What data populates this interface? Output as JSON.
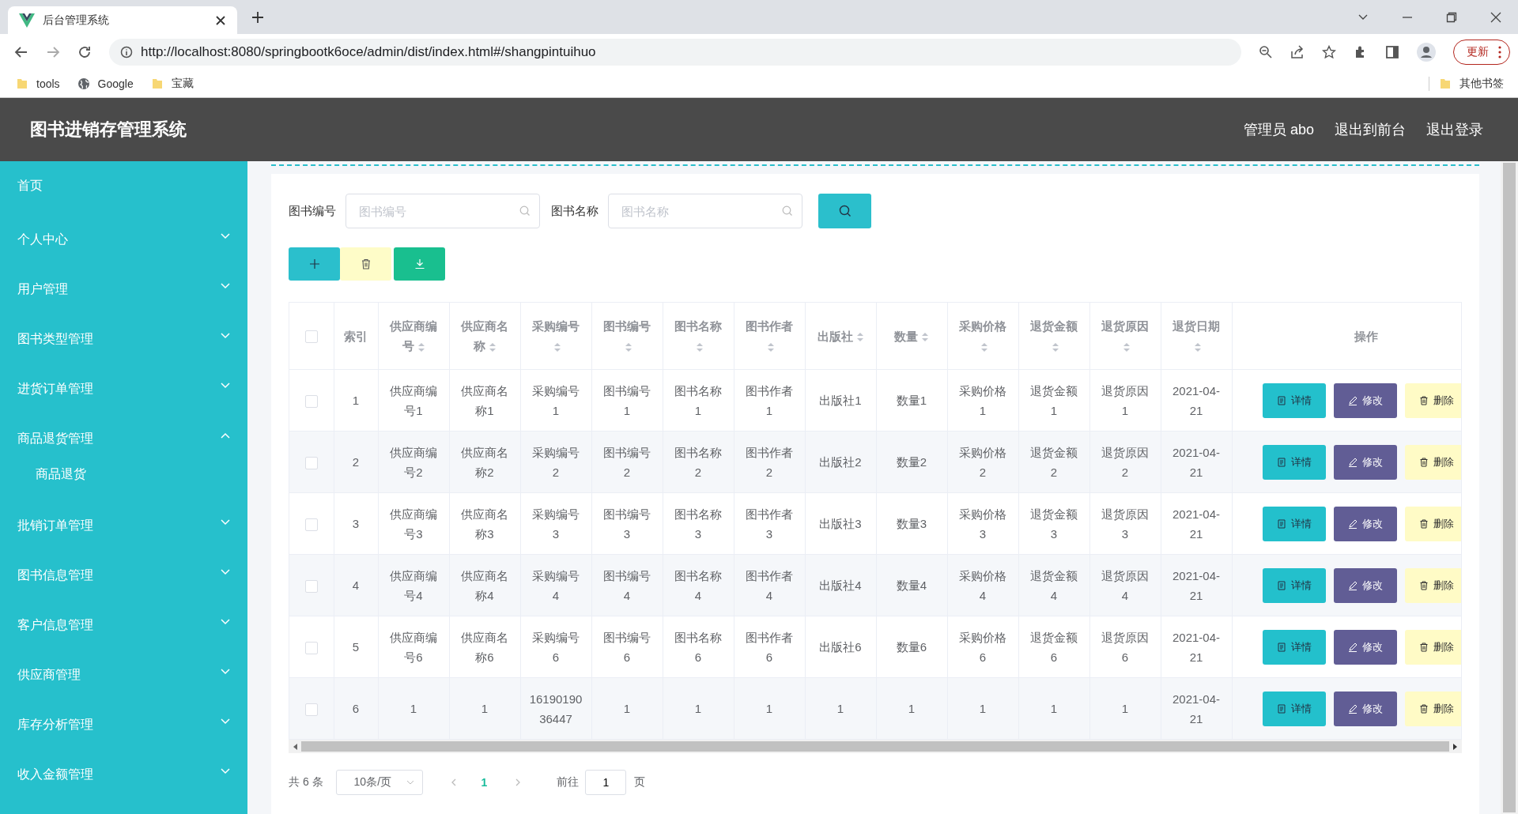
{
  "browser": {
    "tab_title": "后台管理系统",
    "url": "http://localhost:8080/springbootk6oce/admin/dist/index.html#/shangpintuihuo",
    "update_button": "更新",
    "bookmarks": [
      {
        "label": "tools",
        "kind": "folder"
      },
      {
        "label": "Google",
        "kind": "site"
      },
      {
        "label": "宝藏",
        "kind": "folder"
      }
    ],
    "other_bookmarks": "其他书签"
  },
  "header": {
    "title": "图书进销存管理系统",
    "links": [
      "管理员 abo",
      "退出到前台",
      "退出登录"
    ]
  },
  "sidebar": {
    "items": [
      {
        "label": "首页",
        "kind": "link"
      },
      {
        "label": "个人中心",
        "kind": "group",
        "expanded": false
      },
      {
        "label": "用户管理",
        "kind": "group",
        "expanded": false
      },
      {
        "label": "图书类型管理",
        "kind": "group",
        "expanded": false
      },
      {
        "label": "进货订单管理",
        "kind": "group",
        "expanded": false
      },
      {
        "label": "商品退货管理",
        "kind": "group",
        "expanded": true,
        "children": [
          {
            "label": "商品退货"
          }
        ]
      },
      {
        "label": "批销订单管理",
        "kind": "group",
        "expanded": false
      },
      {
        "label": "图书信息管理",
        "kind": "group",
        "expanded": false
      },
      {
        "label": "客户信息管理",
        "kind": "group",
        "expanded": false
      },
      {
        "label": "供应商管理",
        "kind": "group",
        "expanded": false
      },
      {
        "label": "库存分析管理",
        "kind": "group",
        "expanded": false
      },
      {
        "label": "收入金额管理",
        "kind": "group",
        "expanded": false
      }
    ]
  },
  "search": {
    "fields": [
      {
        "label": "图书编号",
        "placeholder": "图书编号"
      },
      {
        "label": "图书名称",
        "placeholder": "图书名称"
      }
    ]
  },
  "toolbar": [
    {
      "kind": "add"
    },
    {
      "kind": "delete"
    },
    {
      "kind": "export"
    }
  ],
  "table": {
    "header_checked": false,
    "columns": [
      {
        "label": "索引",
        "sortable": false
      },
      {
        "label": "供应商编号",
        "sortable": true
      },
      {
        "label": "供应商名称",
        "sortable": true
      },
      {
        "label": "采购编号",
        "sortable": true
      },
      {
        "label": "图书编号",
        "sortable": true
      },
      {
        "label": "图书名称",
        "sortable": true
      },
      {
        "label": "图书作者",
        "sortable": true
      },
      {
        "label": "出版社",
        "sortable": true
      },
      {
        "label": "数量",
        "sortable": true
      },
      {
        "label": "采购价格",
        "sortable": true
      },
      {
        "label": "退货金额",
        "sortable": true
      },
      {
        "label": "退货原因",
        "sortable": true
      },
      {
        "label": "退货日期",
        "sortable": true
      },
      {
        "label": "操作",
        "sortable": false
      }
    ],
    "rows": [
      {
        "checked": false,
        "cells": [
          "1",
          "供应商编号1",
          "供应商名称1",
          "采购编号1",
          "图书编号1",
          "图书名称1",
          "图书作者1",
          "出版社1",
          "数量1",
          "采购价格1",
          "退货金额1",
          "退货原因1",
          "2021-04-21"
        ],
        "actions": [
          "详情",
          "修改",
          "删除"
        ]
      },
      {
        "checked": false,
        "cells": [
          "2",
          "供应商编号2",
          "供应商名称2",
          "采购编号2",
          "图书编号2",
          "图书名称2",
          "图书作者2",
          "出版社2",
          "数量2",
          "采购价格2",
          "退货金额2",
          "退货原因2",
          "2021-04-21"
        ],
        "actions": [
          "详情",
          "修改",
          "删除"
        ]
      },
      {
        "checked": false,
        "cells": [
          "3",
          "供应商编号3",
          "供应商名称3",
          "采购编号3",
          "图书编号3",
          "图书名称3",
          "图书作者3",
          "出版社3",
          "数量3",
          "采购价格3",
          "退货金额3",
          "退货原因3",
          "2021-04-21"
        ],
        "actions": [
          "详情",
          "修改",
          "删除"
        ]
      },
      {
        "checked": false,
        "cells": [
          "4",
          "供应商编号4",
          "供应商名称4",
          "采购编号4",
          "图书编号4",
          "图书名称4",
          "图书作者4",
          "出版社4",
          "数量4",
          "采购价格4",
          "退货金额4",
          "退货原因4",
          "2021-04-21"
        ],
        "actions": [
          "详情",
          "修改",
          "删除"
        ]
      },
      {
        "checked": false,
        "cells": [
          "5",
          "供应商编号6",
          "供应商名称6",
          "采购编号6",
          "图书编号6",
          "图书名称6",
          "图书作者6",
          "出版社6",
          "数量6",
          "采购价格6",
          "退货金额6",
          "退货原因6",
          "2021-04-21"
        ],
        "actions": [
          "详情",
          "修改",
          "删除"
        ]
      },
      {
        "checked": false,
        "cells": [
          "6",
          "1",
          "1",
          "1619019036447",
          "1",
          "1",
          "1",
          "1",
          "1",
          "1",
          "1",
          "1",
          "2021-04-21"
        ],
        "actions": [
          "详情",
          "修改",
          "删除"
        ]
      }
    ]
  },
  "pagination": {
    "total": "共 6 条",
    "page_size": "10条/页",
    "pages": [
      {
        "label": "1",
        "selected": true
      }
    ],
    "goto_label": "前往",
    "goto_value": "1",
    "goto_suffix": "页"
  }
}
